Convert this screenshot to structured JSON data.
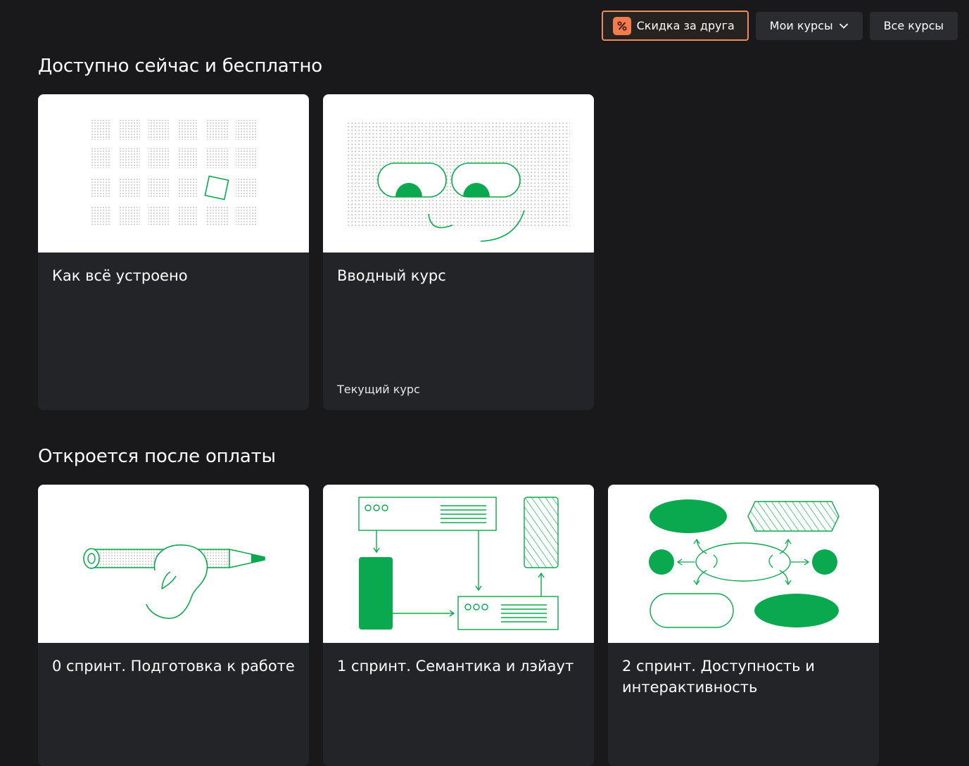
{
  "nav": {
    "promo_label": "Скидка за друга",
    "promo_icon": "percent-icon",
    "my_courses_label": "Мои курсы",
    "all_courses_label": "Все курсы",
    "accent_color": "#f08a5d"
  },
  "sections": [
    {
      "title": "Доступно сейчас и бесплатно",
      "cards": [
        {
          "title": "Как всё устроено",
          "subtitle": ""
        },
        {
          "title": "Вводный курс",
          "subtitle": "Текущий курс"
        }
      ]
    },
    {
      "title": "Откроется после оплаты",
      "cards": [
        {
          "title": "0 спринт. Подготовка к работе",
          "subtitle": ""
        },
        {
          "title": "1 спринт. Семантика и лэйаут",
          "subtitle": ""
        },
        {
          "title": "2 спринт. Доступность и интерактивность",
          "subtitle": ""
        }
      ]
    }
  ],
  "colors": {
    "background": "#19191b",
    "card": "#232428",
    "illustration_green": "#0aa84f"
  }
}
